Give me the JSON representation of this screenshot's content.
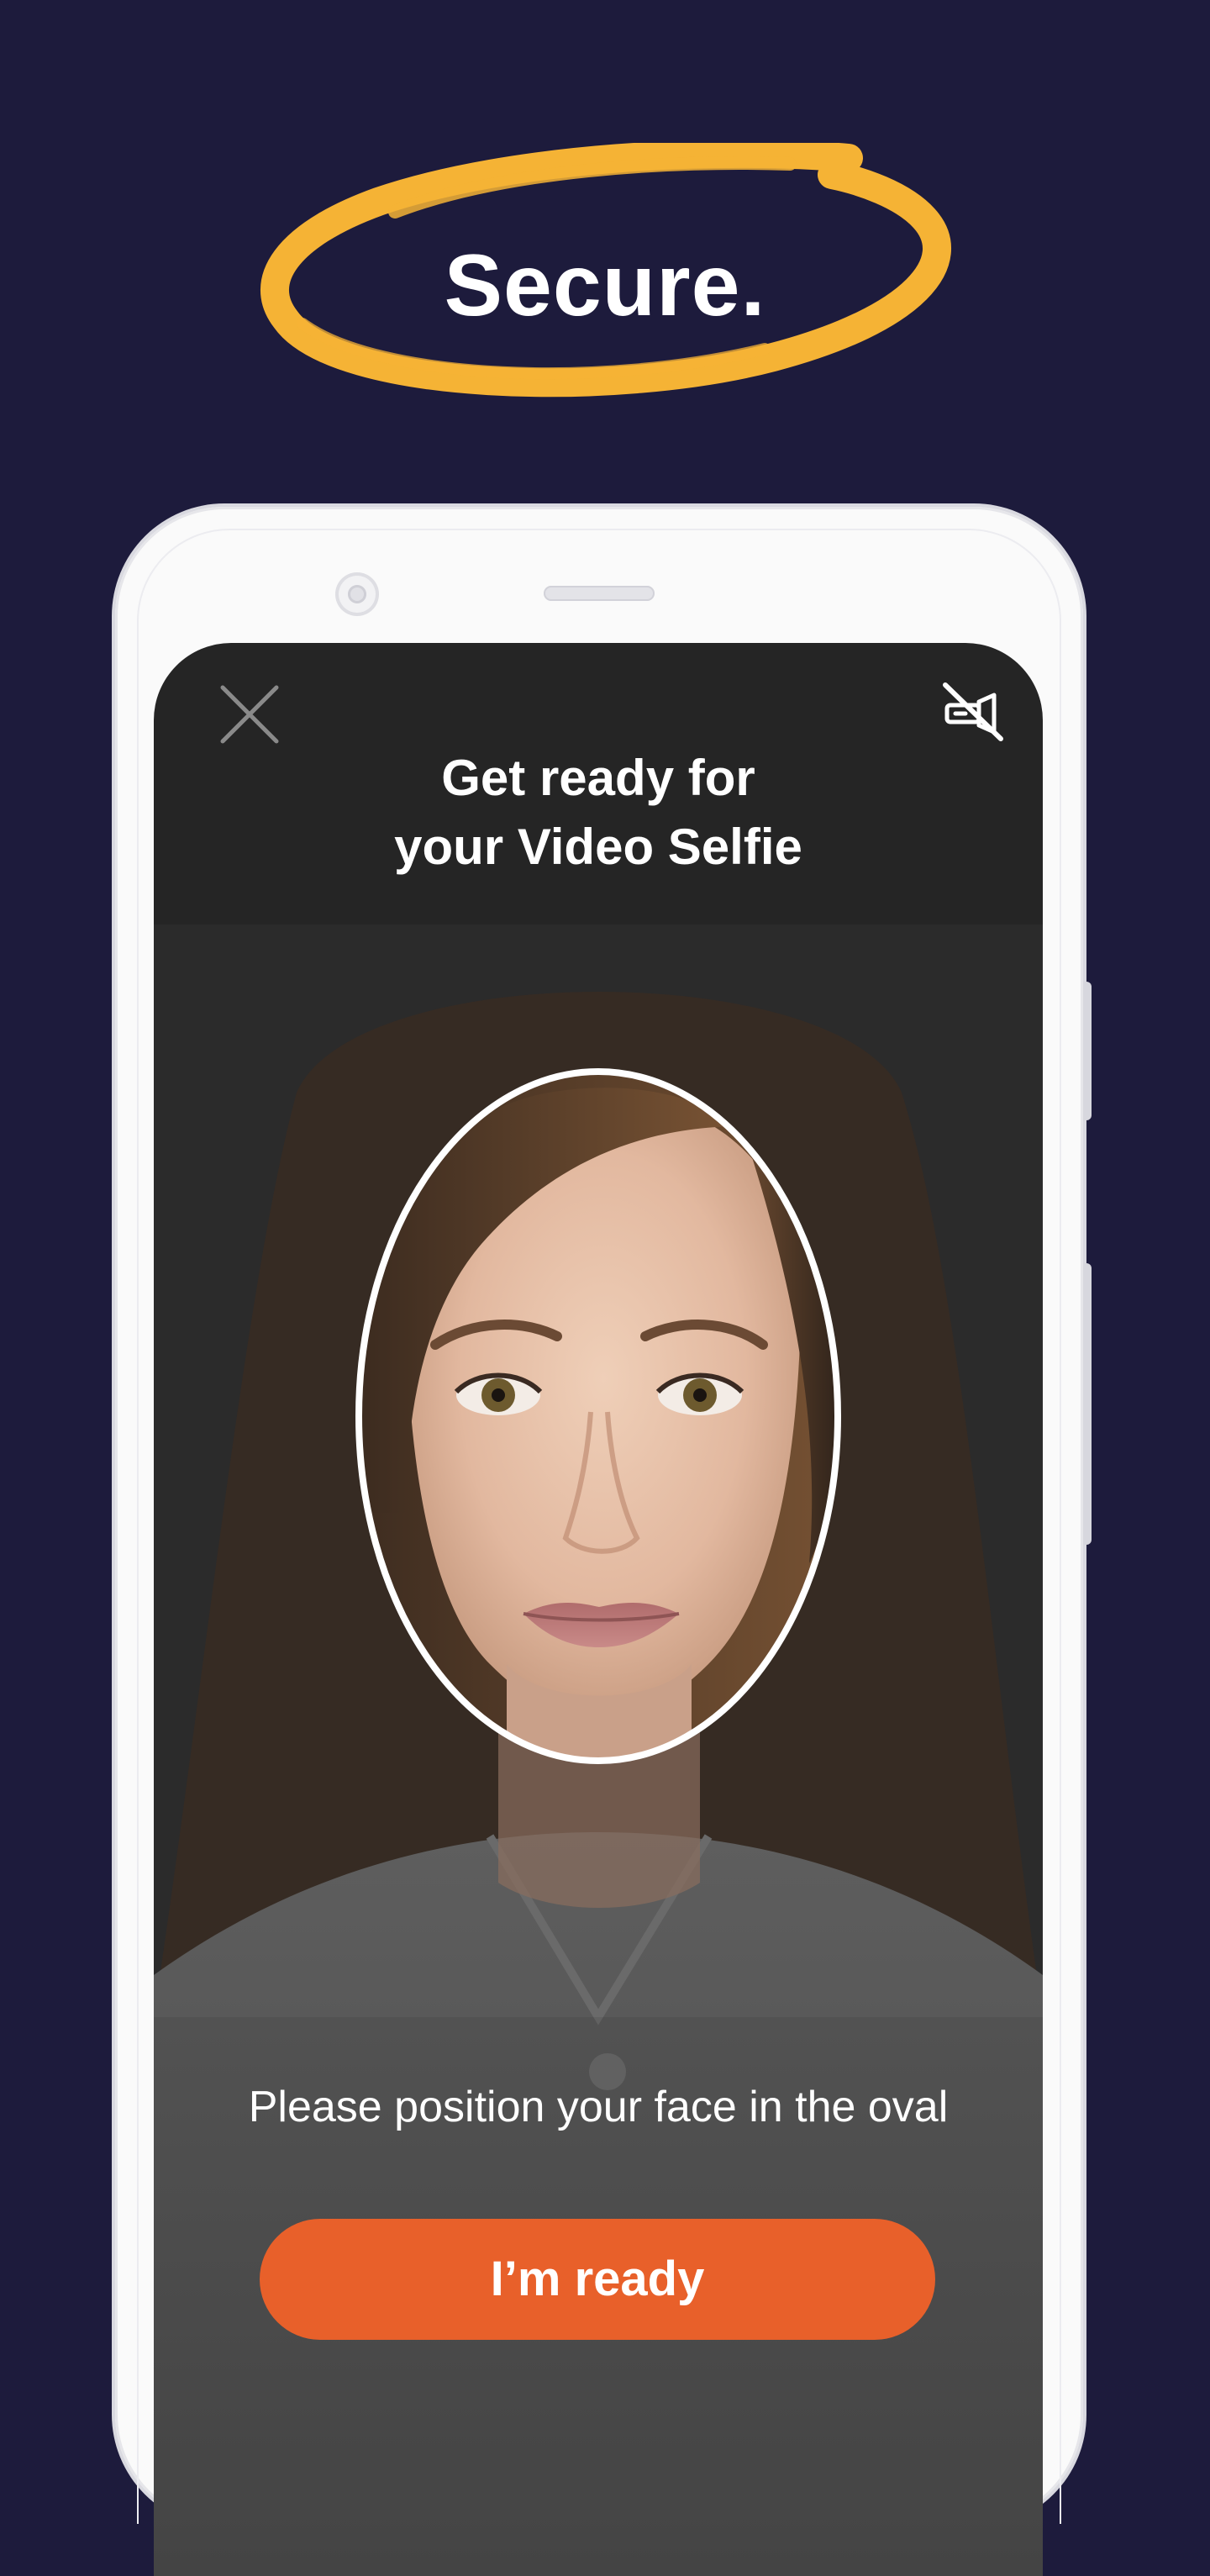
{
  "headline": {
    "text": "Secure."
  },
  "screen": {
    "title_line1": "Get ready for",
    "title_line2": "your Video Selfie",
    "instruction": "Please position your face in the oval",
    "ready_button_label": "I’m ready"
  },
  "icons": {
    "close": "close-icon",
    "flash": "flash-off-icon"
  },
  "colors": {
    "background": "#1d1b3c",
    "accent_scribble": "#f5b335",
    "primary_button": "#e8602a",
    "screen_bg": "#252525",
    "text_light": "#ffffff"
  }
}
